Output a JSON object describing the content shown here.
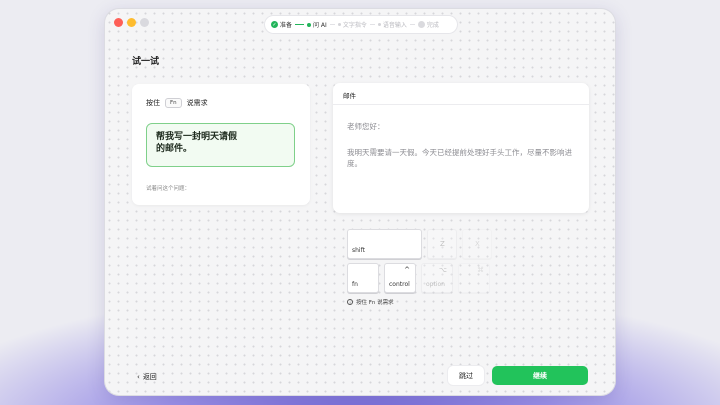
{
  "stepper": {
    "steps": [
      {
        "label": "准备",
        "state": "done"
      },
      {
        "label": "问 AI",
        "state": "active"
      },
      {
        "label": "文字指令",
        "state": "pending"
      },
      {
        "label": "语音输入",
        "state": "pending"
      },
      {
        "label": "完成",
        "state": "pending"
      }
    ]
  },
  "page": {
    "title": "试一试"
  },
  "left_card": {
    "hold_label": "按住",
    "fn_key": "Fn",
    "hold_suffix": "说需求",
    "prompt_line1": "帮我写一封明天请假",
    "prompt_line2": "的邮件。",
    "try_question": "试着问这个问题："
  },
  "mail": {
    "header": "邮件",
    "greeting": "老师您好：",
    "body": "我明天需要请一天假。今天已经提前处理好手头工作，尽量不影响进度。"
  },
  "keyboard": {
    "shift": "shift",
    "z": "Z",
    "x": "X",
    "fn": "fn",
    "control": "control",
    "control_symbol": "^",
    "option": "option",
    "option_symbol": "⌥",
    "command": "⌘",
    "hint": "按住 Fn 说需求"
  },
  "footer": {
    "back_label": "返回",
    "skip_label": "跳过",
    "continue_label": "继续"
  },
  "colors": {
    "accent": "#22c35b",
    "prompt_border": "#7fd08a"
  }
}
